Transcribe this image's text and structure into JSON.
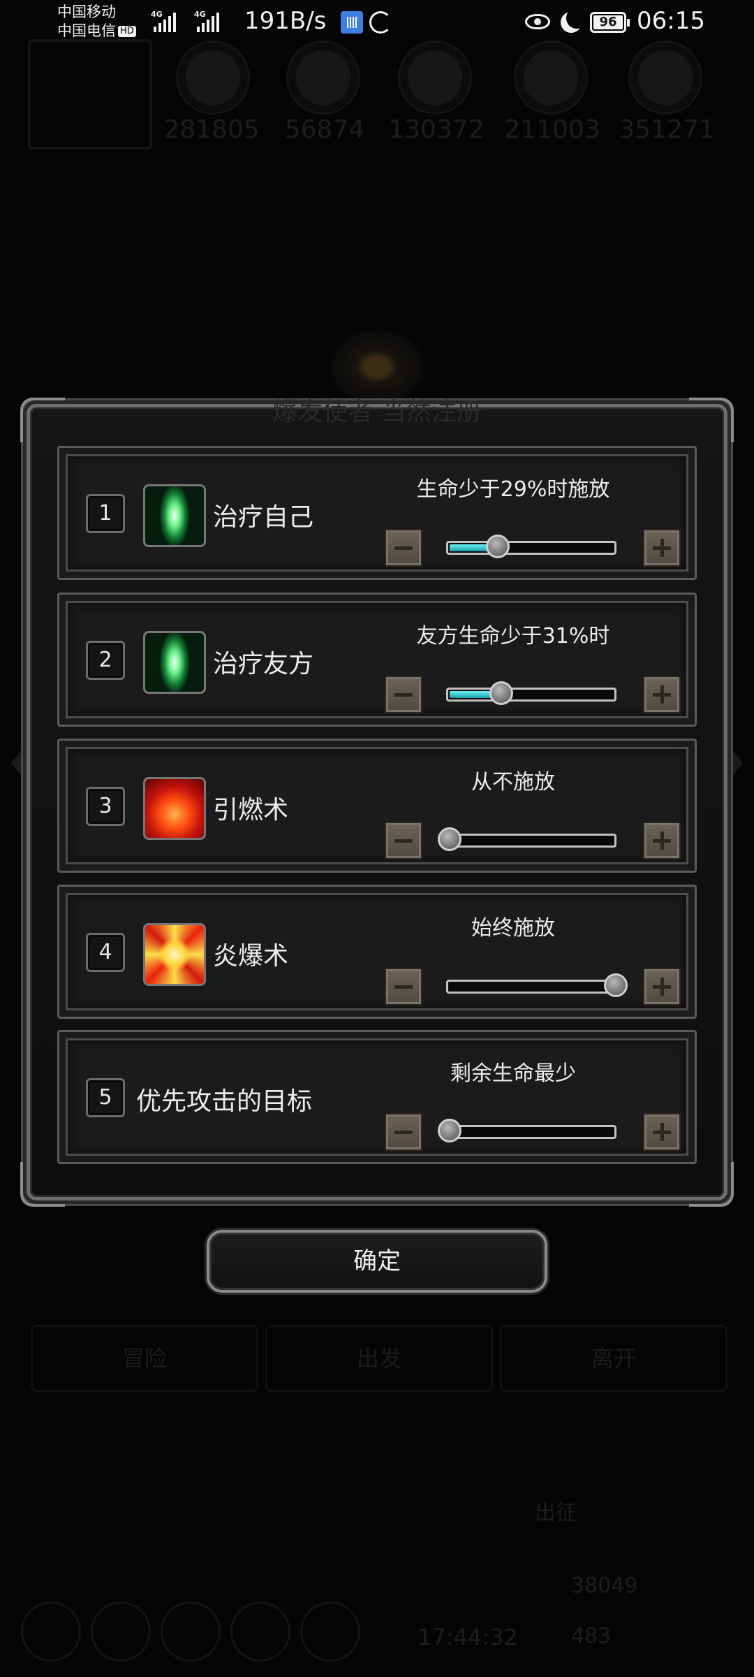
{
  "status_bar": {
    "carrier1": "中国移动",
    "carrier2": "中国电信",
    "hd": "HD",
    "net_tag1": "4G",
    "net_tag2": "4G",
    "net_speed": "191B/s",
    "battery": "96",
    "time": "06:15"
  },
  "background": {
    "resources": [
      "281805",
      "56874",
      "130372",
      "211003",
      "351271"
    ],
    "buttons": [
      "冒险",
      "出发",
      "离开"
    ],
    "bottom_label": "出征",
    "timer": "17:44:32",
    "gold": "38049",
    "gems": "483",
    "dialog_title": "爆发使者 当然注册"
  },
  "dialog": {
    "rows": [
      {
        "index": "1",
        "icon": "heal-icon",
        "name": "治疗自己",
        "condition": "生命少于29%时施放",
        "level": 0.29
      },
      {
        "index": "2",
        "icon": "heal-icon",
        "name": "治疗友方",
        "condition": "友方生命少于31%时",
        "level": 0.31
      },
      {
        "index": "3",
        "icon": "fire-icon",
        "name": "引燃术",
        "condition": "从不施放",
        "level": 0.0
      },
      {
        "index": "4",
        "icon": "explosion-icon",
        "name": "炎爆术",
        "condition": "始终施放",
        "level": 1.0
      },
      {
        "index": "5",
        "icon": "",
        "name": "优先攻击的目标",
        "condition": "剩余生命最少",
        "level": 0.0
      }
    ],
    "confirm_label": "确定"
  },
  "colors": {
    "slider_fill": "#2cc7cf",
    "stepper": "#5e574c",
    "frame": "#6e6e6e"
  }
}
